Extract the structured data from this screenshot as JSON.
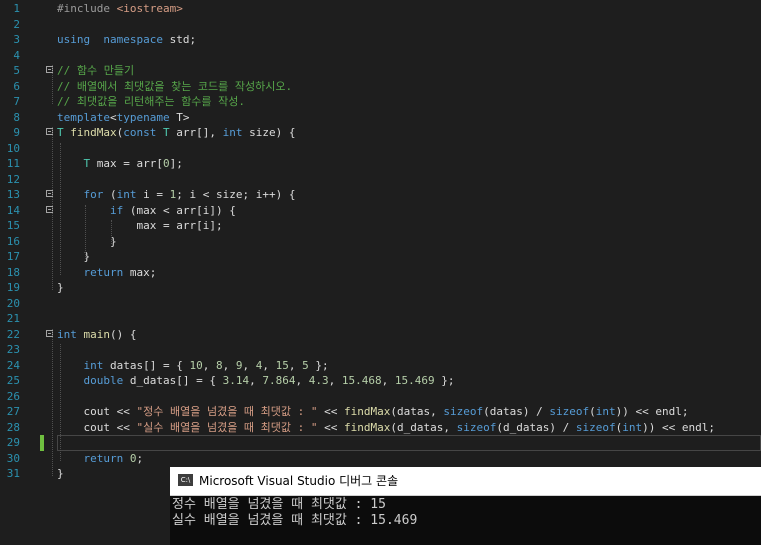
{
  "editor": {
    "line_numbers": [
      "1",
      "2",
      "3",
      "4",
      "5",
      "6",
      "7",
      "8",
      "9",
      "10",
      "11",
      "12",
      "13",
      "14",
      "15",
      "16",
      "17",
      "18",
      "19",
      "20",
      "21",
      "22",
      "23",
      "24",
      "25",
      "26",
      "27",
      "28",
      "29",
      "30",
      "31"
    ],
    "current_line": "29",
    "lines": [
      [
        [
          "pp",
          "#include "
        ],
        [
          "inc",
          "<iostream>"
        ]
      ],
      [],
      [
        [
          "kw",
          "using"
        ],
        [
          "",
          "  "
        ],
        [
          "kw",
          "namespace"
        ],
        [
          "",
          " std;"
        ]
      ],
      [],
      [
        [
          "cm",
          "// 함수 만들기"
        ]
      ],
      [
        [
          "cm",
          "// 배열에서 최댓값을 찾는 코드를 작성하시오."
        ]
      ],
      [
        [
          "cm",
          "// 최댓값을 리턴해주는 함수를 작성."
        ]
      ],
      [
        [
          "kw",
          "template"
        ],
        [
          "",
          "<"
        ],
        [
          "kw",
          "typename"
        ],
        [
          "",
          " T>"
        ]
      ],
      [
        [
          "ty",
          "T"
        ],
        [
          "",
          " "
        ],
        [
          "fn",
          "findMax"
        ],
        [
          "",
          "("
        ],
        [
          "kw",
          "const"
        ],
        [
          "",
          " "
        ],
        [
          "ty",
          "T"
        ],
        [
          "",
          " arr[], "
        ],
        [
          "kw",
          "int"
        ],
        [
          "",
          " size) {"
        ]
      ],
      [],
      [
        [
          "",
          "    "
        ],
        [
          "ty",
          "T"
        ],
        [
          "",
          " max = arr["
        ],
        [
          "num",
          "0"
        ],
        [
          "",
          "];"
        ]
      ],
      [],
      [
        [
          "",
          "    "
        ],
        [
          "kw",
          "for"
        ],
        [
          "",
          " ("
        ],
        [
          "kw",
          "int"
        ],
        [
          "",
          " i = "
        ],
        [
          "num",
          "1"
        ],
        [
          "",
          "; i < size; i++) {"
        ]
      ],
      [
        [
          "",
          "        "
        ],
        [
          "kw",
          "if"
        ],
        [
          "",
          " (max < arr[i]) {"
        ]
      ],
      [
        [
          "",
          "            max = arr[i];"
        ]
      ],
      [
        [
          "",
          "        }"
        ]
      ],
      [
        [
          "",
          "    }"
        ]
      ],
      [
        [
          "",
          "    "
        ],
        [
          "kw",
          "return"
        ],
        [
          "",
          " max;"
        ]
      ],
      [
        [
          "",
          "}"
        ]
      ],
      [],
      [],
      [
        [
          "kw",
          "int"
        ],
        [
          "",
          " "
        ],
        [
          "fn",
          "main"
        ],
        [
          "",
          "() {"
        ]
      ],
      [],
      [
        [
          "",
          "    "
        ],
        [
          "kw",
          "int"
        ],
        [
          "",
          " datas[] = { "
        ],
        [
          "num",
          "10"
        ],
        [
          "",
          ", "
        ],
        [
          "num",
          "8"
        ],
        [
          "",
          ", "
        ],
        [
          "num",
          "9"
        ],
        [
          "",
          ", "
        ],
        [
          "num",
          "4"
        ],
        [
          "",
          ", "
        ],
        [
          "num",
          "15"
        ],
        [
          "",
          ", "
        ],
        [
          "num",
          "5"
        ],
        [
          "",
          " };"
        ]
      ],
      [
        [
          "",
          "    "
        ],
        [
          "kw",
          "double"
        ],
        [
          "",
          " d_datas[] = { "
        ],
        [
          "num",
          "3.14"
        ],
        [
          "",
          ", "
        ],
        [
          "num",
          "7.864"
        ],
        [
          "",
          ", "
        ],
        [
          "num",
          "4.3"
        ],
        [
          "",
          ", "
        ],
        [
          "num",
          "15.468"
        ],
        [
          "",
          ", "
        ],
        [
          "num",
          "15.469"
        ],
        [
          "",
          " };"
        ]
      ],
      [],
      [
        [
          "",
          "    cout << "
        ],
        [
          "str",
          "\"정수 배열을 넘겼을 때 최댓값 : \""
        ],
        [
          "",
          " << "
        ],
        [
          "fn",
          "findMax"
        ],
        [
          "",
          "(datas, "
        ],
        [
          "kw",
          "sizeof"
        ],
        [
          "",
          "(datas) / "
        ],
        [
          "kw",
          "sizeof"
        ],
        [
          "",
          "("
        ],
        [
          "kw",
          "int"
        ],
        [
          "",
          ")) << endl;"
        ]
      ],
      [
        [
          "",
          "    cout << "
        ],
        [
          "str",
          "\"실수 배열을 넘겼을 때 최댓값 : \""
        ],
        [
          "",
          " << "
        ],
        [
          "fn",
          "findMax"
        ],
        [
          "",
          "(d_datas, "
        ],
        [
          "kw",
          "sizeof"
        ],
        [
          "",
          "(d_datas) / "
        ],
        [
          "kw",
          "sizeof"
        ],
        [
          "",
          "("
        ],
        [
          "kw",
          "int"
        ],
        [
          "",
          ")) << endl;"
        ]
      ],
      [],
      [
        [
          "",
          "    "
        ],
        [
          "kw",
          "return"
        ],
        [
          "",
          " "
        ],
        [
          "num",
          "0"
        ],
        [
          "",
          ";"
        ]
      ],
      [
        [
          "",
          "}"
        ]
      ]
    ]
  },
  "console": {
    "icon_label": "C:\\",
    "title": "Microsoft Visual Studio 디버그 콘솔",
    "output": [
      "정수 배열을 넘겼을 때 최댓값 : 15",
      "실수 배열을 넘겼을 때 최댓값 : 15.469"
    ]
  },
  "colors": {
    "background": "#1e1e1e",
    "keyword": "#569cd6",
    "comment": "#57a64a",
    "string": "#d69d85",
    "line_number": "#2b91af",
    "change_marker": "#6fbf3f"
  }
}
